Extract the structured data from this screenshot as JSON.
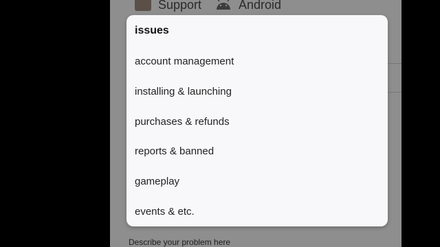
{
  "background_screen": {
    "support_label": "Support",
    "platform_label": "Android",
    "describe_label": "Describe your problem here"
  },
  "dialog": {
    "title": "issues",
    "options": [
      "account management",
      "installing & launching",
      "purchases & refunds",
      "reports & banned",
      "gameplay",
      "events & etc."
    ]
  },
  "colors": {
    "dim_overlay": "#8e8e8e",
    "dialog_bg": "#f8f8fb",
    "outer_bg": "#000000"
  }
}
